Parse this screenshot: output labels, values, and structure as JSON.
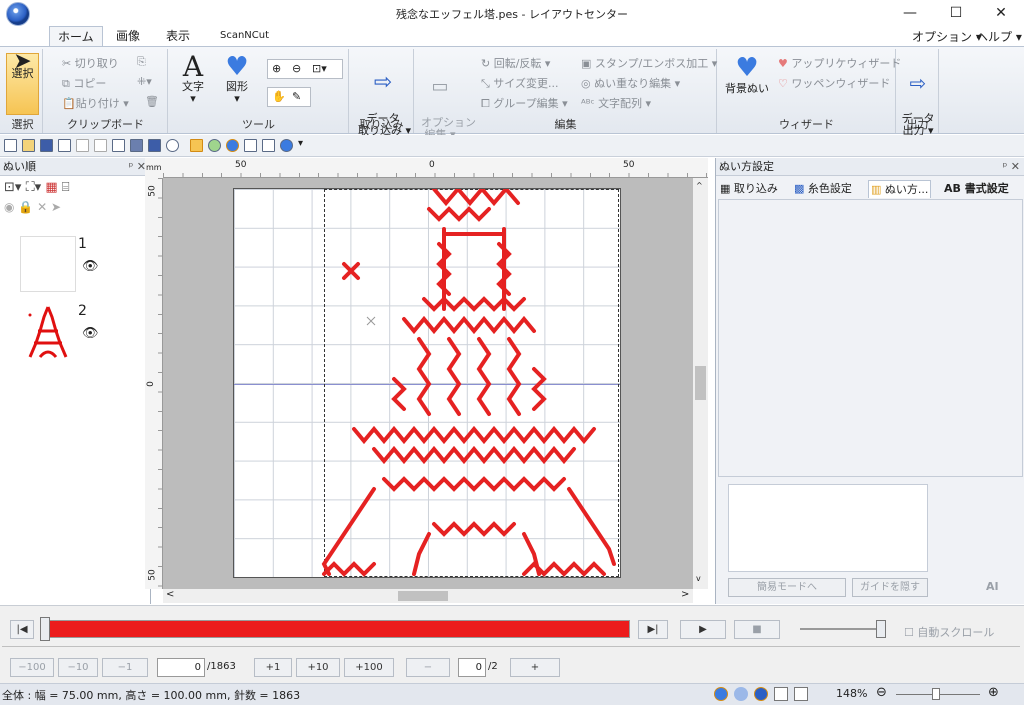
{
  "window": {
    "title": "残念なエッフェル塔.pes - レイアウトセンター",
    "minimize": "—",
    "maximize": "☐",
    "close": "✕"
  },
  "ribbon_tabs": [
    "ホーム",
    "画像",
    "表示",
    "ScanNCut"
  ],
  "menu_right": {
    "options": "オプション ▾",
    "help": "ヘルプ ▾"
  },
  "groups": {
    "select": {
      "label": "選択",
      "btn": "選択"
    },
    "clipboard": {
      "label": "クリップボード",
      "cut": "切り取り",
      "copy": "コピー",
      "paste": "貼り付け ▾"
    },
    "tools": {
      "label": "ツール",
      "text": "文字",
      "shape": "図形"
    },
    "import": {
      "label": "取り込み",
      "btn": "データ\n取り込み ▾"
    },
    "edit": {
      "label": "編集",
      "options": "オプション\n編集 ▾",
      "rotate": "回転/反転 ▾",
      "resize": "サイズ変更...",
      "group": "グループ編集 ▾",
      "stamp": "スタンプ/エンボス加工 ▾",
      "overlap": "ぬい重なり編集 ▾",
      "textarr": "文字配列 ▾"
    },
    "wizard": {
      "label": "ウィザード",
      "bg": "背景ぬい",
      "applique": "アップリケウィザード",
      "patch": "ワッペンウィザード"
    },
    "output": {
      "label": "出力",
      "btn": "データ\n出力 ▾"
    }
  },
  "left_panel": {
    "title": "ぬい順",
    "pin": "ᵖ ✕",
    "items": [
      {
        "num": "1"
      },
      {
        "num": "2"
      }
    ]
  },
  "ruler": {
    "unit": "mm",
    "top": [
      "50",
      "0",
      "50"
    ],
    "left": [
      "50",
      "0",
      "50"
    ]
  },
  "right_panel": {
    "title": "ぬい方設定",
    "pin": "ᵖ ✕",
    "tabs": [
      "取り込み",
      "糸色設定",
      "ぬい方...",
      "AB 書式設定"
    ],
    "simple_mode": "簡易モードへ",
    "hide_guide": "ガイドを隠す"
  },
  "playback": {
    "auto_scroll": "自動スクロール"
  },
  "stepper": {
    "m100": "−100",
    "m10": "−10",
    "m1": "−1",
    "current": "0",
    "total": "/1863",
    "p1": "+1",
    "p10": "+10",
    "p100": "+100",
    "minus": "−",
    "page": "0",
    "pages": "/2",
    "plus": "+"
  },
  "status": {
    "text": "全体 : 幅 = 75.00 mm, 高さ = 100.00 mm, 針数 = 1863",
    "zoom": "148%"
  }
}
